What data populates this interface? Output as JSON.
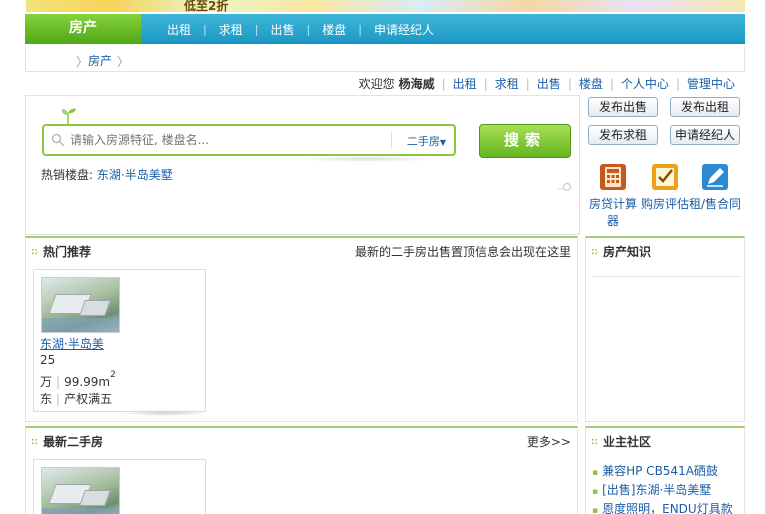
{
  "banner": {
    "text": "低至2折"
  },
  "nav": {
    "home": "房产",
    "items": [
      "出租",
      "求租",
      "出售",
      "楼盘",
      "申请经纪人"
    ]
  },
  "crumb": {
    "current": "房产"
  },
  "userbar": {
    "welcome": "欢迎您",
    "username": "杨海威",
    "links": [
      "出租",
      "求租",
      "出售",
      "楼盘",
      "个人中心",
      "管理中心"
    ]
  },
  "search": {
    "placeholder": "请输入房源特征, 楼盘名...",
    "type_select": "二手房",
    "button": "搜索",
    "hot_label": "热销楼盘:",
    "hot_value": "东湖·半岛美墅"
  },
  "actions": {
    "buttons": [
      "发布出售",
      "发布出租",
      "发布求租",
      "申请经纪人"
    ],
    "tools": [
      "房贷计算器",
      "购房评估",
      "租/售合同"
    ]
  },
  "hot_panel": {
    "title": "热门推荐",
    "note": "最新的二手房出售置顶信息会出现在这里",
    "card": {
      "name": "东湖·半岛美",
      "price": "25",
      "unit": "万",
      "area": "99.99m",
      "area_sup": "2",
      "direction": "东",
      "ownership": "产权满五"
    }
  },
  "know_panel": {
    "title": "房产知识"
  },
  "new_panel": {
    "title": "最新二手房",
    "more": "更多>>"
  },
  "community_panel": {
    "title": "业主社区",
    "items": [
      "兼容HP CB541A硒鼓",
      "[出售]东湖·半岛美墅",
      "恩度照明，ENDU灯具款"
    ]
  },
  "colors": {
    "accent_green": "#8cc63f",
    "nav_blue": "#1c98c4",
    "link_blue": "#1a5ea8"
  }
}
